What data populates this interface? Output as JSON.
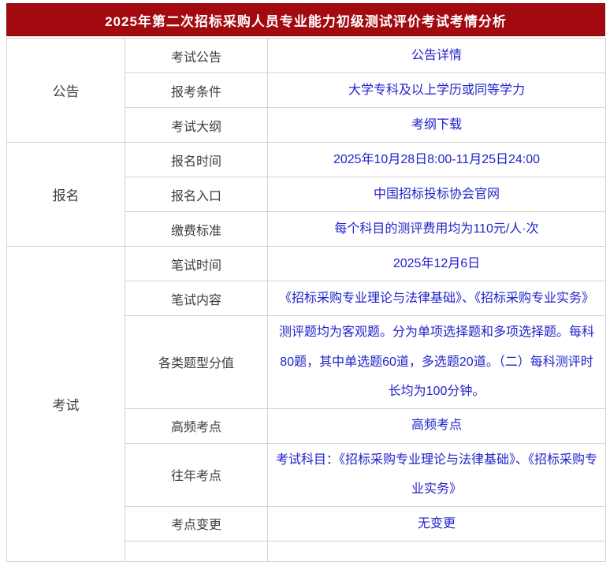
{
  "header": {
    "title": "2025年第二次招标采购人员专业能力初级测试评价考试考情分析"
  },
  "table": {
    "sections": [
      {
        "category": "公告",
        "rows": [
          {
            "label": "考试公告",
            "value": "公告详情"
          },
          {
            "label": "报考条件",
            "value": "大学专科及以上学历或同等学力"
          },
          {
            "label": "考试大纲",
            "value": "考纲下载"
          }
        ]
      },
      {
        "category": "报名",
        "rows": [
          {
            "label": "报名时间",
            "value": "2025年10月28日8:00-11月25日24:00"
          },
          {
            "label": "报名入口",
            "value": "中国招标投标协会官网"
          },
          {
            "label": "缴费标准",
            "value": "每个科目的测评费用均为110元/人·次"
          }
        ]
      },
      {
        "category": "考试",
        "rows": [
          {
            "label": "笔试时间",
            "value": "2025年12月6日"
          },
          {
            "label": "笔试内容",
            "value": "《招标采购专业理论与法律基础》、《招标采购专业实务》"
          },
          {
            "label": "各类题型分值",
            "value": "测评题均为客观题。分为单项选择题和多项选择题。每科80题，其中单选题60道，多选题20道。（二）每科测评时长均为100分钟。"
          },
          {
            "label": "高频考点",
            "value": "高频考点"
          },
          {
            "label": "往年考点",
            "value": "考试科目：《招标采购专业理论与法律基础》、《招标采购专业实务》"
          },
          {
            "label": "考点变更",
            "value": "无变更"
          }
        ]
      }
    ]
  },
  "colors": {
    "banner_red": "#A30A0F",
    "link_blue": "#2123CB",
    "border_gray": "#D2D2D2",
    "text_dark": "#3D3D3D"
  }
}
